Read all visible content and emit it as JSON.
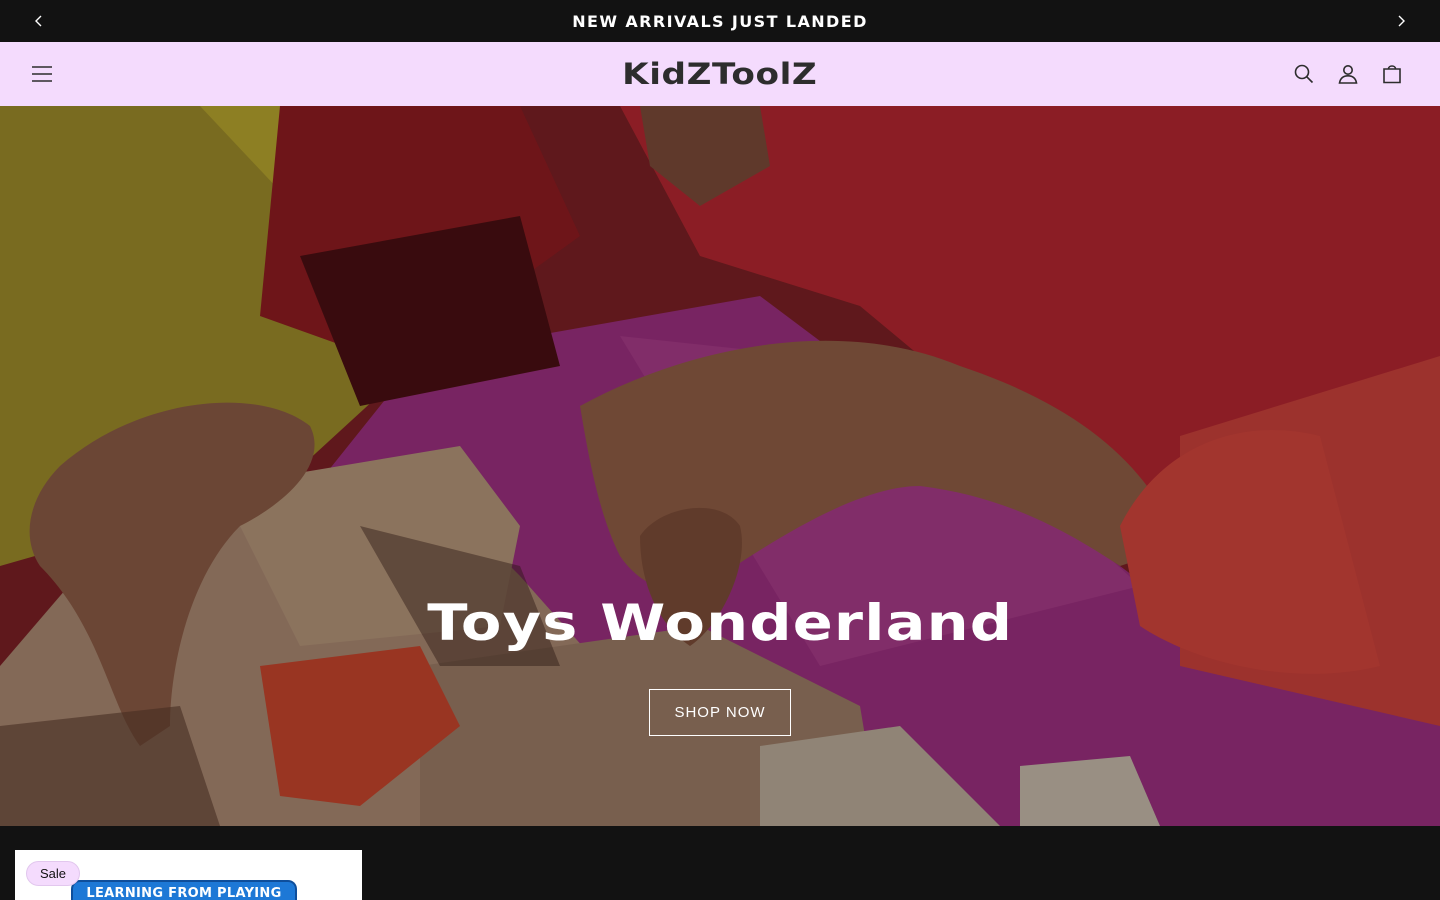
{
  "announcement": {
    "text": "NEW ARRIVALS JUST LANDED",
    "prev_icon": "chevron-left-icon",
    "next_icon": "chevron-right-icon"
  },
  "header": {
    "logo": "KidZToolZ",
    "background": "#f4dbfd",
    "menu_icon": "hamburger-icon",
    "icons": [
      "search-icon",
      "account-icon",
      "cart-icon"
    ]
  },
  "hero": {
    "title": "Toys Wonderland",
    "button_label": "SHOP NOW"
  },
  "products": {
    "items": [
      {
        "badge": "Sale",
        "image_text": "LEARNING FROM PLAYING"
      }
    ]
  },
  "colors": {
    "announcement_bg": "#121212",
    "header_bg": "#f4dbfd",
    "text_dark": "#2d2d2d"
  }
}
